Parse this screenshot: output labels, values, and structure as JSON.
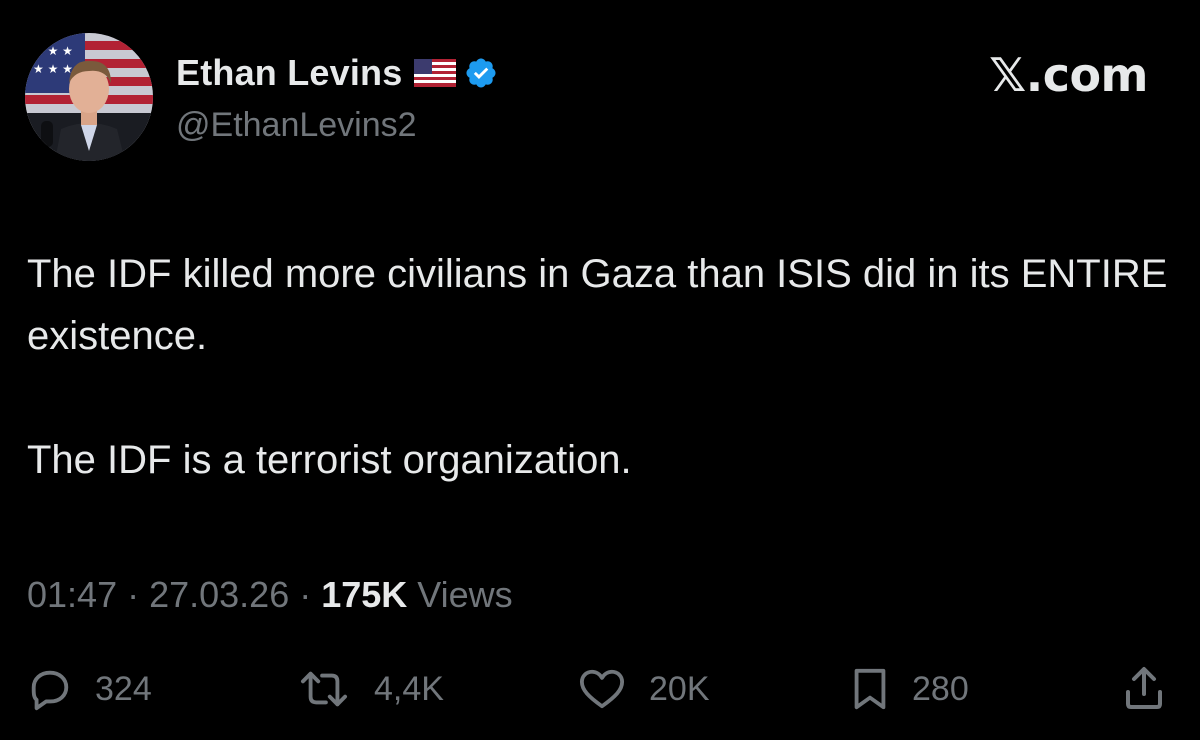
{
  "author": {
    "display_name": "Ethan Levins",
    "handle": "@EthanLevins2",
    "flag_icon": "us-flag-icon",
    "verified_icon": "verified-badge-icon",
    "verified_color": "#1d9bf0"
  },
  "brand": {
    "label": "𝕏.com"
  },
  "tweet": {
    "paragraphs": [
      "The IDF killed more civilians in Gaza than ISIS did in its ENTIRE existence.",
      "The IDF is a terrorist organization."
    ]
  },
  "meta": {
    "time": "01:47",
    "sep1": " · ",
    "date": "27.03.26",
    "sep2": " · ",
    "views_count": "175K",
    "views_label": " Views"
  },
  "actions": {
    "replies": "324",
    "reposts": "4,4K",
    "likes": "20K",
    "bookmarks": "280"
  },
  "colors": {
    "background": "#000000",
    "text_primary": "#e7e9ea",
    "text_secondary": "#71767b"
  }
}
